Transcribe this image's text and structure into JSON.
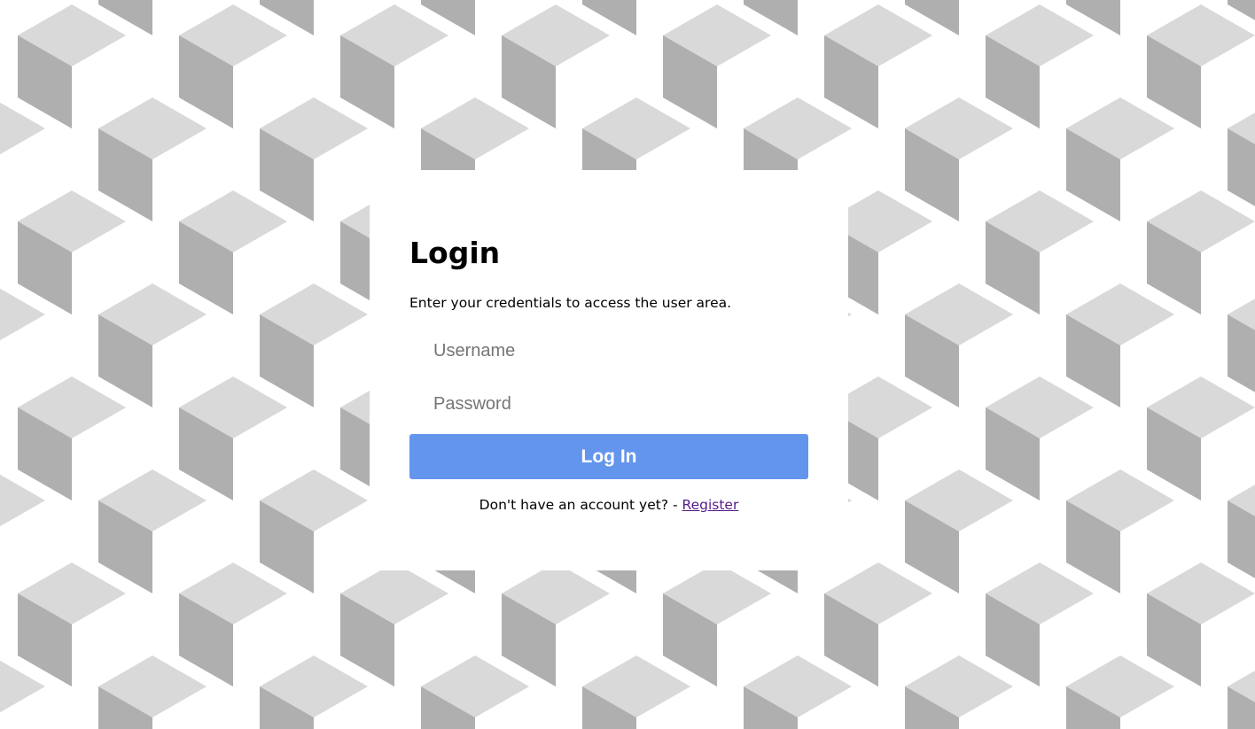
{
  "colors": {
    "page_background": "#ffffff",
    "cube_top": "#d9d9d9",
    "cube_side": "#afafaf",
    "cube_light": "#ffffff",
    "card_background": "#ffffff",
    "button": "#6495ed",
    "link_visited": "#551a8b"
  },
  "login": {
    "title": "Login",
    "subtitle": "Enter your credentials to access the user area.",
    "username_placeholder": "Username",
    "username_value": "",
    "password_placeholder": "Password",
    "password_value": "",
    "submit_label": "Log In",
    "register_prompt": "Don't have an account yet? - ",
    "register_link": "Register"
  }
}
